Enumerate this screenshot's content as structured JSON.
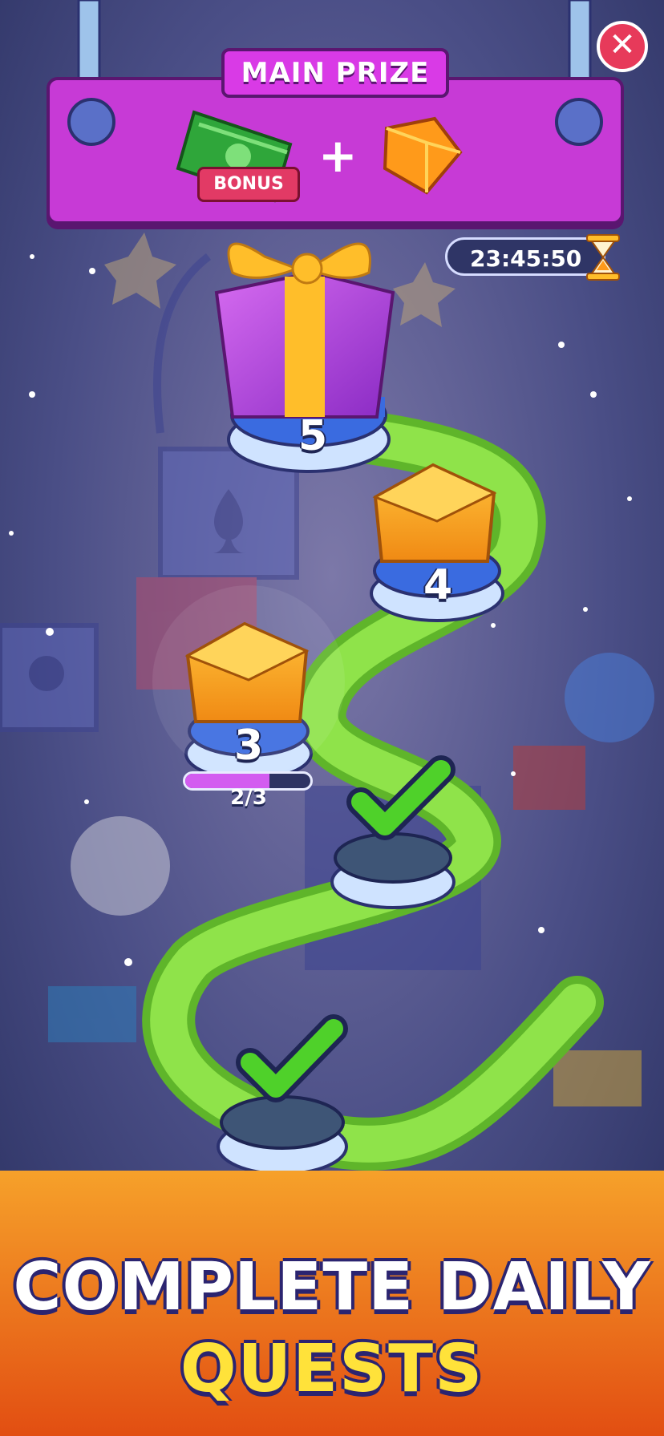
{
  "prize": {
    "title": "MAIN PRIZE",
    "bonus_label": "BONUS",
    "plus": "+"
  },
  "timer": {
    "value": "23:45:50"
  },
  "close": {
    "glyph": "✕"
  },
  "levels": [
    {
      "number": "5",
      "state": "locked",
      "reward": "big-gift-icon"
    },
    {
      "number": "4",
      "state": "locked",
      "reward": "gift-box-icon"
    },
    {
      "number": "3",
      "state": "current",
      "reward": "gift-box-icon",
      "progress_text": "2/3",
      "progress": 0.67
    },
    {
      "number": "",
      "state": "completed",
      "reward": "checkmark-icon"
    },
    {
      "number": "",
      "state": "completed",
      "reward": "checkmark-icon"
    }
  ],
  "footer": {
    "line1": "COMPLETE DAILY",
    "line2": "QUESTS"
  },
  "colors": {
    "banner": "#c73ad6",
    "path": "#8fe34a",
    "footer_top": "#f6a12a",
    "footer_bottom": "#e24e12",
    "accent_yellow": "#ffe23a"
  }
}
